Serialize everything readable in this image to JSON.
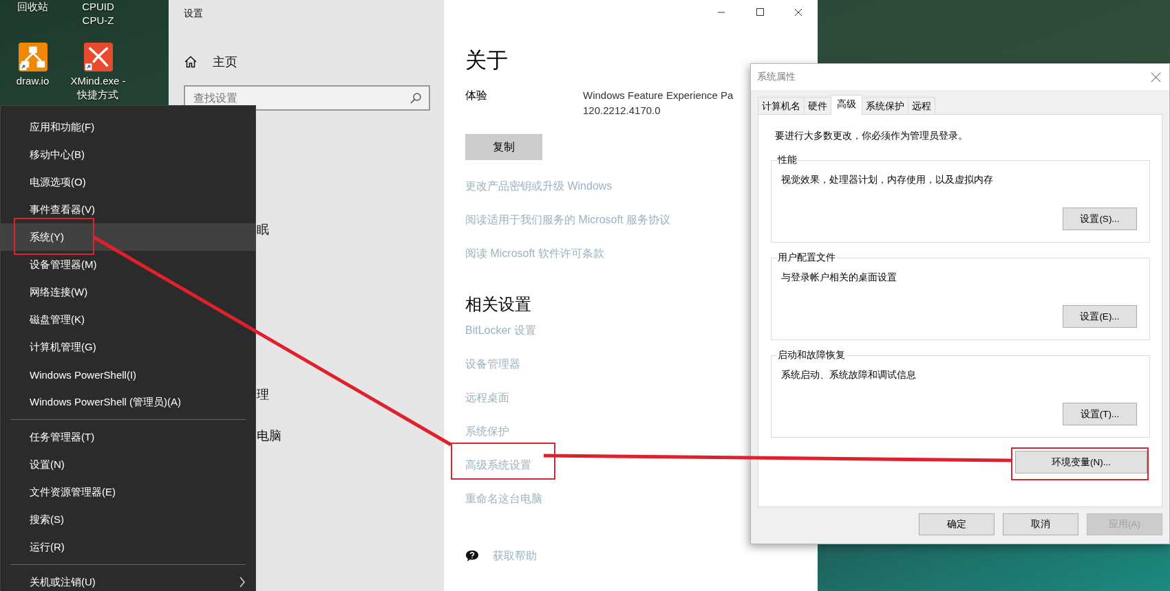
{
  "desktop": {
    "icons": [
      {
        "kind": "cut",
        "label_lines": [
          "回收站"
        ]
      },
      {
        "kind": "cut",
        "label_lines": [
          "CPUID",
          "CPU-Z"
        ]
      },
      {
        "kind": "drawio",
        "label_lines": [
          "draw.io"
        ]
      },
      {
        "kind": "xmind",
        "label_lines": [
          "XMind.exe -",
          "快捷方式"
        ]
      }
    ]
  },
  "settings": {
    "title": "设置",
    "home": "主页",
    "search": {
      "placeholder": "查找设置"
    },
    "nav_fragments": [
      "眠",
      "理",
      "电脑"
    ],
    "page": {
      "title": "关于",
      "spec": {
        "label": "体验",
        "value_lines": [
          "Windows Feature Experience Pa",
          "120.2212.4170.0"
        ]
      },
      "copy_button": "复制",
      "links": [
        "更改产品密钥或升级 Windows",
        "阅读适用于我们服务的 Microsoft 服务协议",
        "阅读 Microsoft 软件许可条款"
      ],
      "related": {
        "title": "相关设置",
        "links": [
          "BitLocker 设置",
          "设备管理器",
          "远程桌面",
          "系统保护",
          "高级系统设置",
          "重命名这台电脑"
        ]
      },
      "help": "获取帮助"
    }
  },
  "context_menu": {
    "groups": [
      {
        "items": [
          {
            "label": "应用和功能(F)",
            "selected": false,
            "submenu": false
          },
          {
            "label": "移动中心(B)",
            "selected": false,
            "submenu": false
          },
          {
            "label": "电源选项(O)",
            "selected": false,
            "submenu": false
          },
          {
            "label": "事件查看器(V)",
            "selected": false,
            "submenu": false
          },
          {
            "label": "系统(Y)",
            "selected": true,
            "submenu": false
          },
          {
            "label": "设备管理器(M)",
            "selected": false,
            "submenu": false
          },
          {
            "label": "网络连接(W)",
            "selected": false,
            "submenu": false
          },
          {
            "label": "磁盘管理(K)",
            "selected": false,
            "submenu": false
          },
          {
            "label": "计算机管理(G)",
            "selected": false,
            "submenu": false
          },
          {
            "label": "Windows PowerShell(I)",
            "selected": false,
            "submenu": false
          },
          {
            "label": "Windows PowerShell (管理员)(A)",
            "selected": false,
            "submenu": false
          }
        ]
      },
      {
        "items": [
          {
            "label": "任务管理器(T)",
            "selected": false,
            "submenu": false
          },
          {
            "label": "设置(N)",
            "selected": false,
            "submenu": false
          },
          {
            "label": "文件资源管理器(E)",
            "selected": false,
            "submenu": false
          },
          {
            "label": "搜索(S)",
            "selected": false,
            "submenu": false
          },
          {
            "label": "运行(R)",
            "selected": false,
            "submenu": false
          }
        ]
      },
      {
        "items": [
          {
            "label": "关机或注销(U)",
            "selected": false,
            "submenu": true
          }
        ]
      }
    ]
  },
  "system_properties": {
    "title": "系统属性",
    "tabs": [
      {
        "label": "计算机名",
        "selected": false
      },
      {
        "label": "硬件",
        "selected": false
      },
      {
        "label": "高级",
        "selected": true
      },
      {
        "label": "系统保护",
        "selected": false
      },
      {
        "label": "远程",
        "selected": false
      }
    ],
    "notice": "要进行大多数更改，你必须作为管理员登录。",
    "groups": [
      {
        "title": "性能",
        "description": "视觉效果，处理器计划，内存使用，以及虚拟内存",
        "button": "设置(S)..."
      },
      {
        "title": "用户配置文件",
        "description": "与登录帐户相关的桌面设置",
        "button": "设置(E)..."
      },
      {
        "title": "启动和故障恢复",
        "description": "系统启动、系统故障和调试信息",
        "button": "设置(T)..."
      }
    ],
    "env_button": "环境变量(N)...",
    "buttons": [
      {
        "label": "确定",
        "disabled": false
      },
      {
        "label": "取消",
        "disabled": false
      },
      {
        "label": "应用(A)",
        "disabled": true
      }
    ]
  }
}
